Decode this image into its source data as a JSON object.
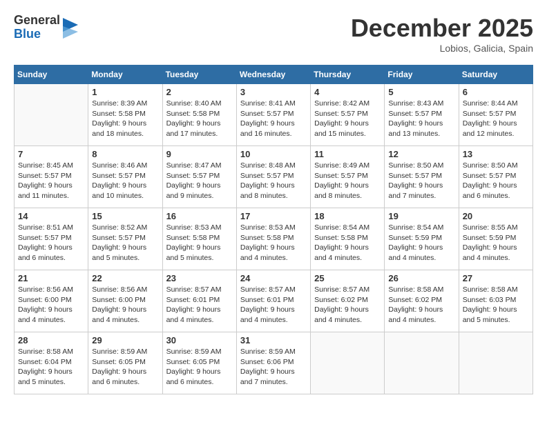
{
  "header": {
    "logo": {
      "general": "General",
      "blue": "Blue"
    },
    "title": "December 2025",
    "location": "Lobios, Galicia, Spain"
  },
  "calendar": {
    "days_of_week": [
      "Sunday",
      "Monday",
      "Tuesday",
      "Wednesday",
      "Thursday",
      "Friday",
      "Saturday"
    ],
    "weeks": [
      [
        {
          "day": "",
          "empty": true
        },
        {
          "day": "1",
          "sunrise": "8:39 AM",
          "sunset": "5:58 PM",
          "daylight": "9 hours and 18 minutes."
        },
        {
          "day": "2",
          "sunrise": "8:40 AM",
          "sunset": "5:58 PM",
          "daylight": "9 hours and 17 minutes."
        },
        {
          "day": "3",
          "sunrise": "8:41 AM",
          "sunset": "5:57 PM",
          "daylight": "9 hours and 16 minutes."
        },
        {
          "day": "4",
          "sunrise": "8:42 AM",
          "sunset": "5:57 PM",
          "daylight": "9 hours and 15 minutes."
        },
        {
          "day": "5",
          "sunrise": "8:43 AM",
          "sunset": "5:57 PM",
          "daylight": "9 hours and 13 minutes."
        },
        {
          "day": "6",
          "sunrise": "8:44 AM",
          "sunset": "5:57 PM",
          "daylight": "9 hours and 12 minutes."
        }
      ],
      [
        {
          "day": "7",
          "sunrise": "8:45 AM",
          "sunset": "5:57 PM",
          "daylight": "9 hours and 11 minutes."
        },
        {
          "day": "8",
          "sunrise": "8:46 AM",
          "sunset": "5:57 PM",
          "daylight": "9 hours and 10 minutes."
        },
        {
          "day": "9",
          "sunrise": "8:47 AM",
          "sunset": "5:57 PM",
          "daylight": "9 hours and 9 minutes."
        },
        {
          "day": "10",
          "sunrise": "8:48 AM",
          "sunset": "5:57 PM",
          "daylight": "9 hours and 8 minutes."
        },
        {
          "day": "11",
          "sunrise": "8:49 AM",
          "sunset": "5:57 PM",
          "daylight": "9 hours and 8 minutes."
        },
        {
          "day": "12",
          "sunrise": "8:50 AM",
          "sunset": "5:57 PM",
          "daylight": "9 hours and 7 minutes."
        },
        {
          "day": "13",
          "sunrise": "8:50 AM",
          "sunset": "5:57 PM",
          "daylight": "9 hours and 6 minutes."
        }
      ],
      [
        {
          "day": "14",
          "sunrise": "8:51 AM",
          "sunset": "5:57 PM",
          "daylight": "9 hours and 6 minutes."
        },
        {
          "day": "15",
          "sunrise": "8:52 AM",
          "sunset": "5:57 PM",
          "daylight": "9 hours and 5 minutes."
        },
        {
          "day": "16",
          "sunrise": "8:53 AM",
          "sunset": "5:58 PM",
          "daylight": "9 hours and 5 minutes."
        },
        {
          "day": "17",
          "sunrise": "8:53 AM",
          "sunset": "5:58 PM",
          "daylight": "9 hours and 4 minutes."
        },
        {
          "day": "18",
          "sunrise": "8:54 AM",
          "sunset": "5:58 PM",
          "daylight": "9 hours and 4 minutes."
        },
        {
          "day": "19",
          "sunrise": "8:54 AM",
          "sunset": "5:59 PM",
          "daylight": "9 hours and 4 minutes."
        },
        {
          "day": "20",
          "sunrise": "8:55 AM",
          "sunset": "5:59 PM",
          "daylight": "9 hours and 4 minutes."
        }
      ],
      [
        {
          "day": "21",
          "sunrise": "8:56 AM",
          "sunset": "6:00 PM",
          "daylight": "9 hours and 4 minutes."
        },
        {
          "day": "22",
          "sunrise": "8:56 AM",
          "sunset": "6:00 PM",
          "daylight": "9 hours and 4 minutes."
        },
        {
          "day": "23",
          "sunrise": "8:57 AM",
          "sunset": "6:01 PM",
          "daylight": "9 hours and 4 minutes."
        },
        {
          "day": "24",
          "sunrise": "8:57 AM",
          "sunset": "6:01 PM",
          "daylight": "9 hours and 4 minutes."
        },
        {
          "day": "25",
          "sunrise": "8:57 AM",
          "sunset": "6:02 PM",
          "daylight": "9 hours and 4 minutes."
        },
        {
          "day": "26",
          "sunrise": "8:58 AM",
          "sunset": "6:02 PM",
          "daylight": "9 hours and 4 minutes."
        },
        {
          "day": "27",
          "sunrise": "8:58 AM",
          "sunset": "6:03 PM",
          "daylight": "9 hours and 5 minutes."
        }
      ],
      [
        {
          "day": "28",
          "sunrise": "8:58 AM",
          "sunset": "6:04 PM",
          "daylight": "9 hours and 5 minutes."
        },
        {
          "day": "29",
          "sunrise": "8:59 AM",
          "sunset": "6:05 PM",
          "daylight": "9 hours and 6 minutes."
        },
        {
          "day": "30",
          "sunrise": "8:59 AM",
          "sunset": "6:05 PM",
          "daylight": "9 hours and 6 minutes."
        },
        {
          "day": "31",
          "sunrise": "8:59 AM",
          "sunset": "6:06 PM",
          "daylight": "9 hours and 7 minutes."
        },
        {
          "day": "",
          "empty": true
        },
        {
          "day": "",
          "empty": true
        },
        {
          "day": "",
          "empty": true
        }
      ]
    ],
    "labels": {
      "sunrise": "Sunrise:",
      "sunset": "Sunset:",
      "daylight": "Daylight:"
    }
  }
}
